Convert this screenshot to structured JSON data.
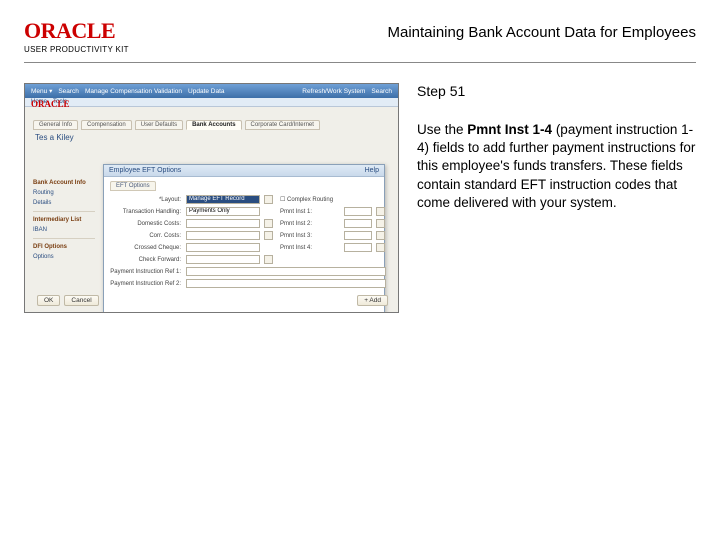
{
  "brand": {
    "logo": "ORACLE",
    "sub": "USER PRODUCTIVITY KIT"
  },
  "title": "Maintaining Bank Account Data for Employees",
  "step": {
    "label": "Step 51",
    "text1": "Use the ",
    "bold": "Pmnt Inst 1-4",
    "text2": " (payment instruction 1-4) fields to add further payment instructions for this employee's funds transfers. These fields contain standard EFT instruction codes that come delivered with your system."
  },
  "shot": {
    "topbar": [
      "Menu ▾",
      "Search",
      "Manage Compensation Validation",
      "Update Data",
      "Refresh/Work System",
      "Search"
    ],
    "navbar": [
      "Home",
      "Tools"
    ],
    "applogo": "ORACLE",
    "tabs": [
      "General Info",
      "Compensation",
      "User Defaults",
      "Bank Accounts",
      "Corporate Card/Internet"
    ],
    "employee": "Tes a Kiley",
    "side": [
      "Bank Account Info",
      "Routing",
      "Details",
      "Intermediary List",
      "IBAN",
      "DFI Options",
      "Options"
    ],
    "modal": {
      "title": "Employee EFT Options",
      "help": "Help",
      "subtabs": [
        "EFT Options"
      ],
      "rows": [
        {
          "l": "*Layout:",
          "v": "Manage EFT Record",
          "r": "☐  Complex Routing"
        },
        {
          "l": "Transaction Handling:",
          "v": "Payments Only"
        },
        {
          "l": "Pmnt Inst 1:"
        },
        {
          "l": "Domestic Costs:"
        },
        {
          "l": "Pmnt Inst 2:"
        },
        {
          "l": "Corr. Costs:"
        },
        {
          "l": "Pmnt Inst 3:"
        },
        {
          "l": "Crossed Cheque:"
        },
        {
          "l": "Pmnt Inst 4:"
        },
        {
          "l": "Check Forward:"
        },
        {
          "l": "Payment Instruction Ref 1:"
        },
        {
          "l": "Payment Instruction Ref 2:"
        }
      ]
    },
    "buttons": {
      "ok": "OK",
      "cancel": "Cancel",
      "add": "+ Add"
    }
  }
}
